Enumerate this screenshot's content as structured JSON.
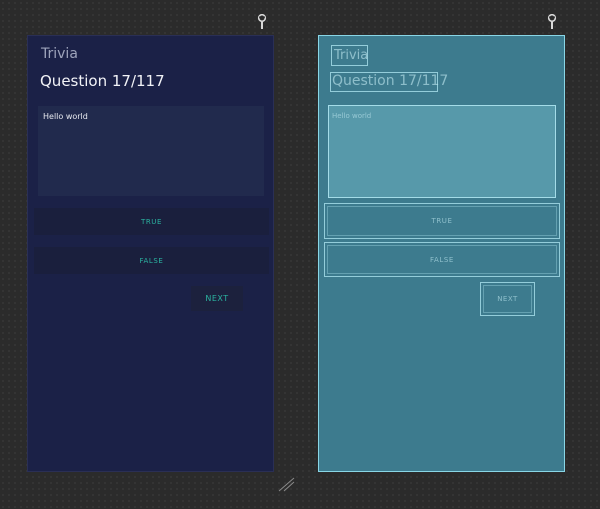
{
  "app": {
    "title": "Trivia",
    "question_counter": "Question 17/117"
  },
  "question": {
    "text": "Hello world"
  },
  "buttons": {
    "true_label": "TRUE",
    "false_label": "FALSE",
    "next_label": "NEXT"
  },
  "icons": {
    "design_pin": "pin-icon",
    "blueprint_pin": "pin-icon",
    "resize": "resize-handle-icon"
  },
  "colors": {
    "canvas": "#2b2b2b",
    "design_background": "#1b2147",
    "card_background": "#212a4d",
    "accent_teal": "#2bb3a0",
    "blueprint_background": "#3d7b8e",
    "blueprint_outline": "#89d6e6"
  }
}
